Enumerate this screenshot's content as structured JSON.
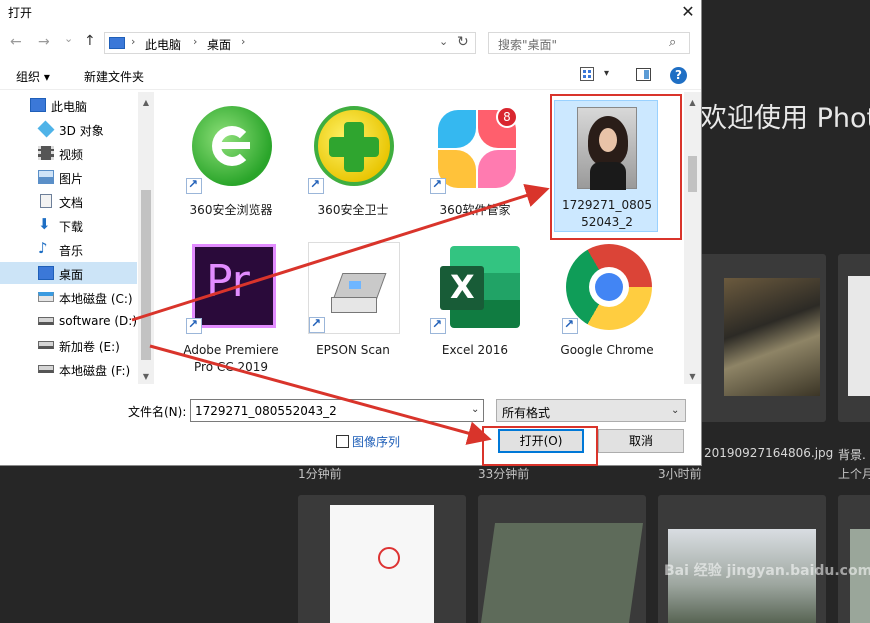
{
  "photoshop": {
    "welcome": "欢迎使用 Photo",
    "recent_files": [
      {
        "name": "",
        "time": "1分钟前"
      },
      {
        "name": "",
        "time": "33分钟前"
      },
      {
        "name": "20190927164806.jpg",
        "time": "3小时前"
      },
      {
        "name": "背景.",
        "time": "上个月"
      }
    ],
    "watermark": "Bai 经验 jingyan.baidu.com"
  },
  "dialog": {
    "title": "打开",
    "close_label": "✕",
    "nav": {
      "back": "←",
      "forward": "→",
      "dropdown": "⌄",
      "up": "↑"
    },
    "address": {
      "crumbs": [
        "此电脑",
        "桌面"
      ],
      "separator": "›",
      "dropdown": "⌄",
      "refresh": "↻"
    },
    "search": {
      "placeholder": "搜索\"桌面\"",
      "icon": "⌕"
    },
    "toolbar": {
      "organize": "组织 ▾",
      "new_folder": "新建文件夹",
      "help": "?",
      "view_dd": "▾"
    },
    "tree": [
      {
        "label": "此电脑",
        "icon": "computer-icon",
        "color": "#3b78d8"
      },
      {
        "label": "3D 对象",
        "icon": "cube-icon",
        "color": "#4fb3e8"
      },
      {
        "label": "视频",
        "icon": "video-icon",
        "color": "#555555"
      },
      {
        "label": "图片",
        "icon": "picture-icon",
        "color": "#5a8fc8"
      },
      {
        "label": "文档",
        "icon": "document-icon",
        "color": "#6d7f99"
      },
      {
        "label": "下载",
        "icon": "download-icon",
        "color": "#1f6fc4"
      },
      {
        "label": "音乐",
        "icon": "music-icon",
        "color": "#1f6fc4"
      },
      {
        "label": "桌面",
        "icon": "desktop-icon",
        "color": "#3b78d8",
        "selected": true
      },
      {
        "label": "本地磁盘 (C:)",
        "icon": "windows-drive-icon",
        "color": "#3b9be0"
      },
      {
        "label": "software (D:)",
        "icon": "drive-icon",
        "color": "#666666"
      },
      {
        "label": "新加卷 (E:)",
        "icon": "drive-icon",
        "color": "#666666"
      },
      {
        "label": "本地磁盘 (F:)",
        "icon": "drive-icon",
        "color": "#666666"
      }
    ],
    "files": [
      {
        "name": "360安全浏览器",
        "icon": "360-browser-icon"
      },
      {
        "name": "360安全卫士",
        "icon": "360-security-icon"
      },
      {
        "name": "360软件管家",
        "icon": "360-software-manager-icon",
        "badge": "8"
      },
      {
        "name": "1729271_0805520​43_2",
        "icon": "photo-thumbnail-icon",
        "selected": true
      },
      {
        "name": "Adobe Premiere Pro CC 2019",
        "icon": "premiere-pro-icon",
        "logo_text": "Pr"
      },
      {
        "name": "EPSON Scan",
        "icon": "epson-scanner-icon"
      },
      {
        "name": "Excel 2016",
        "icon": "excel-icon",
        "logo_text": "X"
      },
      {
        "name": "Google Chrome",
        "icon": "chrome-icon"
      }
    ],
    "filename_label": "文件名(N):",
    "filename_value": "1729271_080552043_2",
    "filetype_value": "所有格式",
    "image_sequence_label": "图像序列",
    "open_button": "打开(O)",
    "cancel_button": "取消"
  }
}
